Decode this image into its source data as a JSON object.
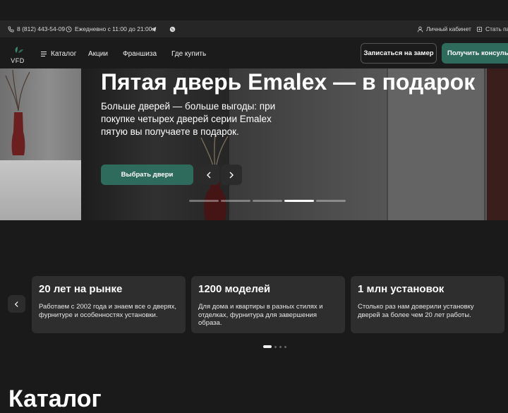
{
  "topbar": {
    "phone": "8 (812) 443-54-09",
    "hours": "Ежедневно с 11:00 до 21:00",
    "account": "Личный кабинет",
    "partner": "Стать пар"
  },
  "logo": {
    "text": "VFD"
  },
  "nav": {
    "items": [
      "Каталог",
      "Акции",
      "Франшиза",
      "Где купить"
    ],
    "measure_button": "Записаться на замер",
    "consult_button": "Получить консульта"
  },
  "hero": {
    "title": "Пятая дверь Emalex — в подарок",
    "text": "Больше дверей — больше выгоды: при покупке четырех дверей серии Emalex пятую вы получаете в подарок.",
    "cta": "Выбрать двери",
    "slides_total": 5,
    "slide_active": 4
  },
  "stats": {
    "cards": [
      {
        "title": "20 лет на рынке",
        "text": "Работаем с 2002 года и знаем все о дверях, фурнитуре и особенностях установки."
      },
      {
        "title": "1200 моделей",
        "text": "Для дома и квартиры в разных стилях и отделках, фурнитура для завершения образа."
      },
      {
        "title": "1 млн установок",
        "text": "Столько раз нам доверили установку дверей за более чем 20 лет работы."
      }
    ],
    "pages_total": 4,
    "page_active": 1
  },
  "catalog": {
    "title": "Каталог"
  },
  "colors": {
    "accent": "#2f6b5d",
    "background": "#1a1a1a",
    "card": "#2e2e2e"
  }
}
